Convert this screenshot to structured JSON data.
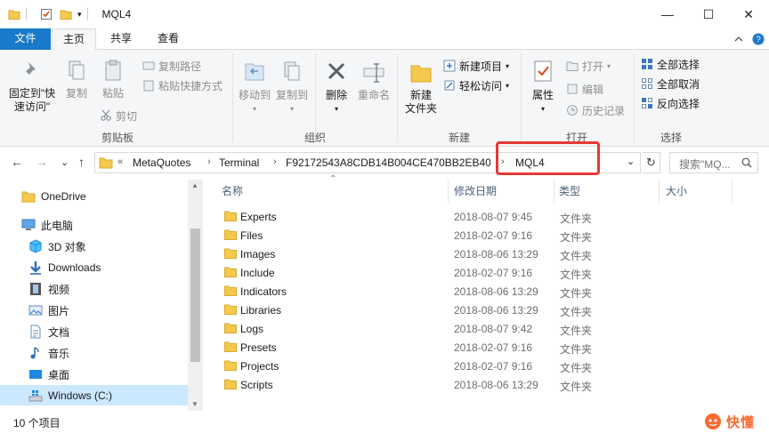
{
  "window": {
    "title": "MQL4",
    "minimize": "—",
    "maximize": "☐",
    "close": "✕"
  },
  "tabs": [
    "文件",
    "主页",
    "共享",
    "查看"
  ],
  "ribbon": {
    "clipboard": {
      "label": "剪贴板",
      "pin": [
        "固定到\"快",
        "速访问\""
      ],
      "copy": "复制",
      "paste": "粘贴",
      "copy_path": "复制路径",
      "paste_shortcut": "粘贴快捷方式",
      "cut": "剪切"
    },
    "organize": {
      "label": "组织",
      "move_to": "移动到",
      "copy_to": "复制到",
      "delete": "删除",
      "rename": "重命名"
    },
    "new": {
      "label": "新建",
      "new_folder": [
        "新建",
        "文件夹"
      ],
      "new_item": "新建项目",
      "easy_access": "轻松访问"
    },
    "open": {
      "label": "打开",
      "properties": "属性",
      "open": "打开",
      "edit": "编辑",
      "history": "历史记录"
    },
    "select": {
      "label": "选择",
      "select_all": "全部选择",
      "select_none": "全部取消",
      "invert": "反向选择"
    }
  },
  "address": {
    "back": "←",
    "forward": "→",
    "recent": "⌄",
    "up": "↑",
    "overflow": "«",
    "crumbs": [
      "MetaQuotes",
      "Terminal",
      "F92172543A8CDB14B004CE470BB2EB40",
      "MQL4"
    ],
    "dropdown": "⌄",
    "refresh": "↻",
    "search_placeholder": "搜索\"MQ..."
  },
  "navpane": {
    "items": [
      {
        "label": "OneDrive",
        "icon": "folder-icon"
      },
      {
        "label": "此电脑",
        "icon": "computer-icon"
      },
      {
        "label": "3D 对象",
        "icon": "cube-icon"
      },
      {
        "label": "Downloads",
        "icon": "download-arrow-icon"
      },
      {
        "label": "视频",
        "icon": "film-icon"
      },
      {
        "label": "图片",
        "icon": "picture-icon"
      },
      {
        "label": "文档",
        "icon": "document-icon"
      },
      {
        "label": "音乐",
        "icon": "music-note-icon"
      },
      {
        "label": "桌面",
        "icon": "desktop-icon"
      },
      {
        "label": "Windows (C:)",
        "icon": "drive-icon"
      }
    ]
  },
  "columns": {
    "name": "名称",
    "date": "修改日期",
    "type": "类型",
    "size": "大小"
  },
  "files": [
    {
      "name": "Experts",
      "date": "2018-08-07 9:45",
      "type": "文件夹"
    },
    {
      "name": "Files",
      "date": "2018-02-07 9:16",
      "type": "文件夹"
    },
    {
      "name": "Images",
      "date": "2018-08-06 13:29",
      "type": "文件夹"
    },
    {
      "name": "Include",
      "date": "2018-02-07 9:16",
      "type": "文件夹"
    },
    {
      "name": "Indicators",
      "date": "2018-08-06 13:29",
      "type": "文件夹"
    },
    {
      "name": "Libraries",
      "date": "2018-08-06 13:29",
      "type": "文件夹"
    },
    {
      "name": "Logs",
      "date": "2018-08-07 9:42",
      "type": "文件夹"
    },
    {
      "name": "Presets",
      "date": "2018-02-07 9:16",
      "type": "文件夹"
    },
    {
      "name": "Projects",
      "date": "2018-02-07 9:16",
      "type": "文件夹"
    },
    {
      "name": "Scripts",
      "date": "2018-08-06 13:29",
      "type": "文件夹"
    }
  ],
  "status": {
    "count": "10 个项目"
  },
  "watermark": {
    "text": "快懂"
  },
  "colors": {
    "accent": "#1979ca",
    "highlight": "#e53935",
    "folder": "#f4c94d",
    "selected": "#cce8ff"
  }
}
